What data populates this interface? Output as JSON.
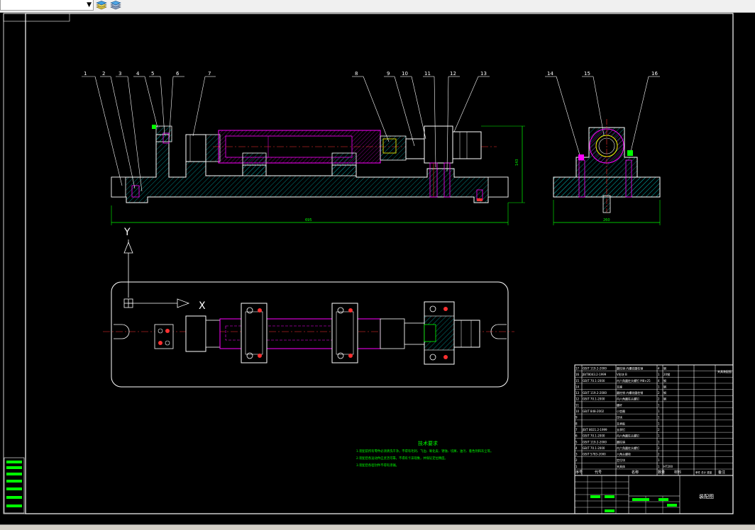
{
  "app": {
    "layer_combo_value": "",
    "toolbar_icons": [
      "layer-states-icon",
      "layer-properties-icon"
    ]
  },
  "drawing": {
    "part_numbers": [
      "1",
      "2",
      "3",
      "4",
      "5",
      "6",
      "7",
      "8",
      "9",
      "10",
      "11",
      "12",
      "13",
      "14",
      "15",
      "16"
    ],
    "dimension_overall_length": "695",
    "dimension_height": "143",
    "dimension_side_width": "260",
    "axis_y_label": "Y",
    "axis_x_label": "X",
    "tech_req_title": "技术要求",
    "tech_req_lines": [
      "1.装配前所有零件必须清洗干净，不得有毛刺、飞边、氧化皮、锈蚀、切屑、油污、着色剂和灰尘等。",
      "2.装配后各运动件应灵活可靠，不得有卡滞现象，并保证定位精度。",
      "3.装配后各密封件不得有渗漏。"
    ]
  },
  "bom": {
    "header": [
      "序号",
      "代号",
      "名称",
      "数量",
      "材料",
      "单件 总计 重量",
      "备注"
    ],
    "rows": [
      [
        "17",
        "GB/T 119.2-2000",
        "圆柱销 内螺纹圆柱销",
        "4",
        "钢",
        "",
        ""
      ],
      [
        "16",
        "JB/T8043.2-1999",
        "V形块 B",
        "1",
        "20钢",
        "",
        ""
      ],
      [
        "15",
        "GB/T 70.1-2000",
        "内六角圆柱头螺钉 M8×25",
        "4",
        "钢",
        "",
        ""
      ],
      [
        "14",
        "",
        "支座",
        "1",
        "钢",
        "",
        ""
      ],
      [
        "13",
        "GB/T 119.2-2000",
        "圆柱销 内螺纹圆柱销",
        "2",
        "钢",
        "",
        ""
      ],
      [
        "12",
        "GB/T 70.1-2000",
        "内六角圆柱头螺钉",
        "2",
        "钢",
        "",
        ""
      ],
      [
        "11",
        "",
        "螺杆",
        "1",
        "",
        "",
        ""
      ],
      [
        "10",
        "GB/T 848-2002",
        "小垫圈",
        "1",
        "",
        "",
        ""
      ],
      [
        "9",
        "",
        "压块",
        "1",
        "",
        "",
        ""
      ],
      [
        "8",
        "",
        "支承板",
        "1",
        "",
        "",
        ""
      ],
      [
        "7",
        "JB/T 8021.2-1999",
        "支承钉",
        "2",
        "",
        "",
        ""
      ],
      [
        "6",
        "GB/T 70.1-2000",
        "内六角圆柱头螺钉",
        "1",
        "",
        "",
        ""
      ],
      [
        "5",
        "GB/T 119.2-2000",
        "圆柱销",
        "1",
        "",
        "",
        ""
      ],
      [
        "4",
        "GB/T 70.1-2000",
        "内六角圆柱头螺钉",
        "2",
        "",
        "",
        ""
      ],
      [
        "3",
        "GB/T 5783-2000",
        "六角头螺栓",
        "2",
        "",
        "",
        ""
      ],
      [
        "2",
        "",
        "定位块",
        "1",
        "",
        "",
        ""
      ],
      [
        "1",
        "",
        "夹具体",
        "1",
        "HT200",
        "",
        ""
      ]
    ],
    "title_block_name": "装配图",
    "title_block_label": "夹具装配图"
  },
  "colors": {
    "frame": "#ffffff",
    "hatch": "#00c8c8",
    "part_outline": "#ffffff",
    "magenta": "#ff00ff",
    "green": "#00ff00",
    "red": "#ff3030",
    "yellow": "#ffff00"
  }
}
